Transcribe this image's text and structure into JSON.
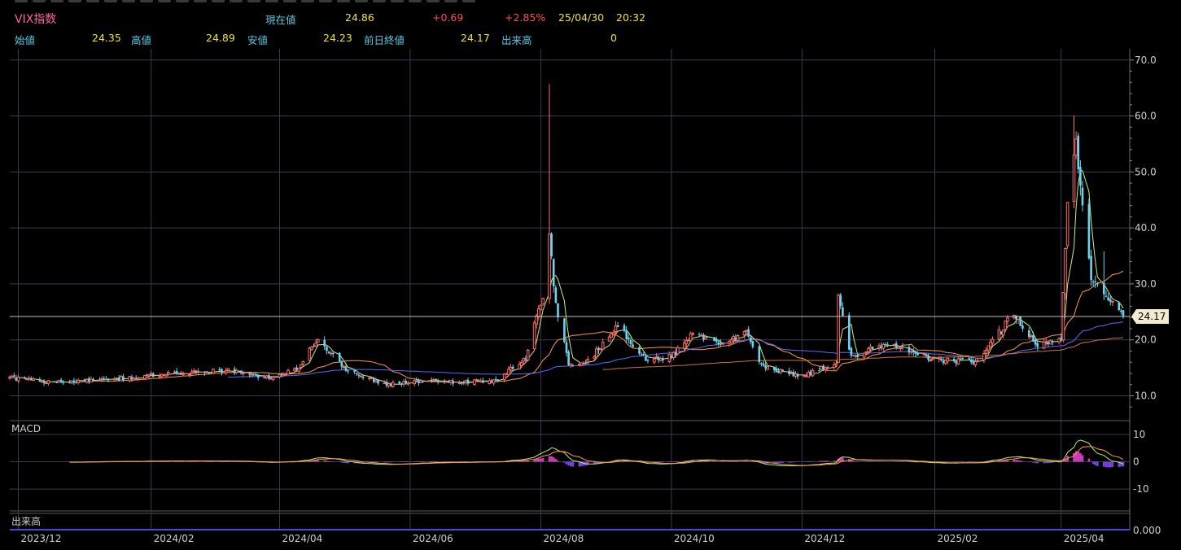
{
  "header": {
    "title": "VIX指数",
    "current_label": "現在値",
    "current_value": "24.86",
    "change": "+0.69",
    "change_pct": "+2.85%",
    "date": "25/04/30",
    "time": "20:32",
    "open_label": "始値",
    "open_value": "24.35",
    "high_label": "高値",
    "high_value": "24.89",
    "low_label": "安値",
    "low_value": "24.23",
    "prev_close_label": "前日終値",
    "prev_close_value": "24.17",
    "volume_label": "出来高",
    "volume_value": "0"
  },
  "colors": {
    "up": "#ff6a6a",
    "down": "#6ed2ee",
    "ma_short": "#c8f07a",
    "ma_mid": "#ff9a3c",
    "ma_long": "#5a6cff",
    "ma_longest": "#c8783c",
    "macd": "#b8f06e",
    "signal": "#ff9a3c",
    "histogram_pos": "#d03cc0",
    "histogram_neg": "#7a40e0",
    "grid": "#3a3a52",
    "current_line": "#bfbfbf"
  },
  "chart_data": [
    {
      "type": "candlestick",
      "title": "",
      "x_labels": [
        "2023/12",
        "2024/02",
        "2024/04",
        "2024/06",
        "2024/08",
        "2024/10",
        "2024/12",
        "2025/02",
        "2025/04"
      ],
      "y_ticks": [
        "10.0",
        "20.0",
        "30.0",
        "40.0",
        "50.0",
        "60.0",
        "70.0"
      ],
      "ylim": [
        6,
        72
      ],
      "current_price_label": "24.17",
      "x_range": [
        "2023-11-27",
        "2025-04-30"
      ],
      "profile": [
        [
          "2023-11-27",
          13.2
        ],
        [
          "2023-12-15",
          12.4
        ],
        [
          "2024-01-10",
          12.8
        ],
        [
          "2024-01-31",
          13.6
        ],
        [
          "2024-02-20",
          14.2
        ],
        [
          "2024-03-08",
          14.6
        ],
        [
          "2024-03-28",
          13.1
        ],
        [
          "2024-04-10",
          15.2
        ],
        [
          "2024-04-19",
          20.2
        ],
        [
          "2024-05-02",
          14.8
        ],
        [
          "2024-05-20",
          12.0
        ],
        [
          "2024-06-05",
          12.6
        ],
        [
          "2024-06-26",
          12.4
        ],
        [
          "2024-07-12",
          12.8
        ],
        [
          "2024-07-25",
          17.0
        ],
        [
          "2024-08-02",
          28.0
        ],
        [
          "2024-08-05",
          38.6
        ],
        [
          "2024-08-08",
          26.0
        ],
        [
          "2024-08-14",
          16.0
        ],
        [
          "2024-08-22",
          15.6
        ],
        [
          "2024-09-06",
          22.4
        ],
        [
          "2024-09-20",
          16.2
        ],
        [
          "2024-10-01",
          17.0
        ],
        [
          "2024-10-10",
          21.0
        ],
        [
          "2024-10-25",
          19.5
        ],
        [
          "2024-11-05",
          21.4
        ],
        [
          "2024-11-12",
          15.3
        ],
        [
          "2024-11-29",
          13.4
        ],
        [
          "2024-12-17",
          15.8
        ],
        [
          "2024-12-18",
          27.6
        ],
        [
          "2024-12-24",
          16.8
        ],
        [
          "2025-01-10",
          19.6
        ],
        [
          "2025-01-31",
          16.4
        ],
        [
          "2025-02-21",
          16.0
        ],
        [
          "2025-03-10",
          24.8
        ],
        [
          "2025-03-20",
          19.0
        ],
        [
          "2025-04-01",
          20.2
        ],
        [
          "2025-04-04",
          45.3
        ],
        [
          "2025-04-08",
          55.0
        ],
        [
          "2025-04-15",
          30.0
        ],
        [
          "2025-04-22",
          28.2
        ],
        [
          "2025-04-30",
          24.17
        ]
      ],
      "spikes": [
        [
          "2024-08-05",
          65.7
        ],
        [
          "2025-04-07",
          60.1
        ],
        [
          "2025-04-09",
          57.0
        ],
        [
          "2024-12-18",
          28.3
        ],
        [
          "2025-04-21",
          35.8
        ]
      ],
      "moving_averages": [
        "ma_short",
        "ma_mid",
        "ma_long",
        "ma_longest"
      ]
    },
    {
      "type": "line",
      "title": "MACD",
      "y_ticks": [
        "10",
        "0",
        "-10"
      ],
      "ylim": [
        -18,
        15
      ],
      "series": [
        "macd",
        "signal",
        "histogram"
      ]
    },
    {
      "type": "bar",
      "title": "出来高",
      "y_ticks": [
        "0.000"
      ],
      "values": [
        0
      ]
    }
  ]
}
